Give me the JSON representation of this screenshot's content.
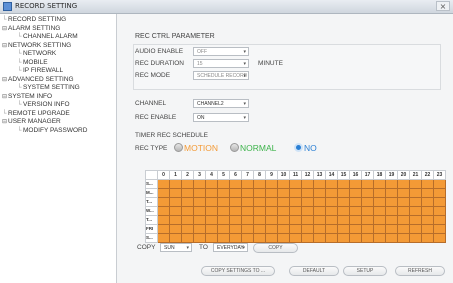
{
  "window": {
    "title": "RECORD SETTING",
    "close": "×"
  },
  "tree": [
    {
      "label": "RECORD SETTING",
      "level": 0,
      "prefix": "line"
    },
    {
      "label": "ALARM SETTING",
      "level": 0,
      "prefix": "minus"
    },
    {
      "label": "CHANNEL ALARM",
      "level": 1,
      "prefix": "line"
    },
    {
      "label": "NETWORK SETTING",
      "level": 0,
      "prefix": "minus"
    },
    {
      "label": "NETWORK",
      "level": 1,
      "prefix": "line"
    },
    {
      "label": "MOBILE",
      "level": 1,
      "prefix": "line"
    },
    {
      "label": "IP FIREWALL",
      "level": 1,
      "prefix": "line"
    },
    {
      "label": "ADVANCED SETTING",
      "level": 0,
      "prefix": "minus"
    },
    {
      "label": "SYSTEM SETTING",
      "level": 1,
      "prefix": "line"
    },
    {
      "label": "SYSTEM INFO",
      "level": 0,
      "prefix": "minus"
    },
    {
      "label": "VERSION INFO",
      "level": 1,
      "prefix": "line"
    },
    {
      "label": "REMOTE UPGRADE",
      "level": 0,
      "prefix": "line"
    },
    {
      "label": "USER MANAGER",
      "level": 0,
      "prefix": "minus"
    },
    {
      "label": "MODIFY PASSWORD",
      "level": 1,
      "prefix": "line"
    }
  ],
  "rec_ctrl": {
    "heading": "REC CTRL PARAMETER",
    "audio_label": "AUDIO ENABLE",
    "audio_value": "OFF",
    "duration_label": "REC DURATION",
    "duration_value": "15",
    "duration_unit": "MINUTE",
    "mode_label": "REC MODE",
    "mode_value": "SCHEDULE RECORD"
  },
  "channel": {
    "label": "CHANNEL",
    "value": "CHANNEL2"
  },
  "rec_enable": {
    "label": "REC ENABLE",
    "value": "ON"
  },
  "schedule": {
    "heading": "TIMER REC SCHEDULE",
    "type_label": "REC TYPE",
    "types": [
      {
        "label": "MOTION",
        "color": "#f39a36",
        "selected": false
      },
      {
        "label": "NORMAL",
        "color": "#3cb34a",
        "selected": false
      },
      {
        "label": "NO",
        "color": "#2a7fd4",
        "selected": true
      }
    ],
    "hours": [
      "0",
      "1",
      "2",
      "3",
      "4",
      "5",
      "6",
      "7",
      "8",
      "9",
      "10",
      "11",
      "12",
      "13",
      "14",
      "15",
      "16",
      "17",
      "18",
      "19",
      "20",
      "21",
      "22",
      "23"
    ],
    "days": [
      "S...",
      "M...",
      "T...",
      "W...",
      "T...",
      "FRI",
      "S..."
    ],
    "cell_color": "#f39a36"
  },
  "copy": {
    "label": "COPY",
    "from": "SUN",
    "to_label": "TO",
    "to": "EVERYDAY",
    "button": "COPY"
  },
  "buttons": {
    "copy_settings": "COPY SETTINGS TO ...",
    "default": "DEFAULT",
    "setup": "SETUP",
    "refresh": "REFRESH"
  }
}
